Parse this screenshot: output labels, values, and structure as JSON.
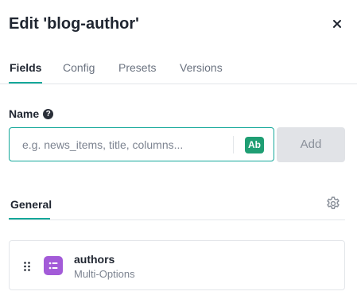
{
  "header": {
    "title": "Edit 'blog-author'",
    "close_icon": "close-icon"
  },
  "tabs": [
    {
      "label": "Fields",
      "active": true
    },
    {
      "label": "Config",
      "active": false
    },
    {
      "label": "Presets",
      "active": false
    },
    {
      "label": "Versions",
      "active": false
    }
  ],
  "name_field": {
    "label": "Name",
    "help_icon": "question-circle-icon",
    "help_glyph": "?",
    "value": "",
    "placeholder": "e.g. news_items, title, columns...",
    "case_toggle_label": "Ab",
    "add_label": "Add"
  },
  "groups": {
    "tabs": [
      {
        "label": "General",
        "active": true
      }
    ],
    "settings_icon": "gear-icon"
  },
  "fields": [
    {
      "name": "authors",
      "type": "Multi-Options",
      "icon": "list-icon",
      "icon_color": "#a35bd8"
    }
  ],
  "colors": {
    "accent": "#14a89a",
    "ab_badge": "#1f9e73",
    "text_primary": "#1f2530",
    "text_muted": "#6b7380"
  }
}
